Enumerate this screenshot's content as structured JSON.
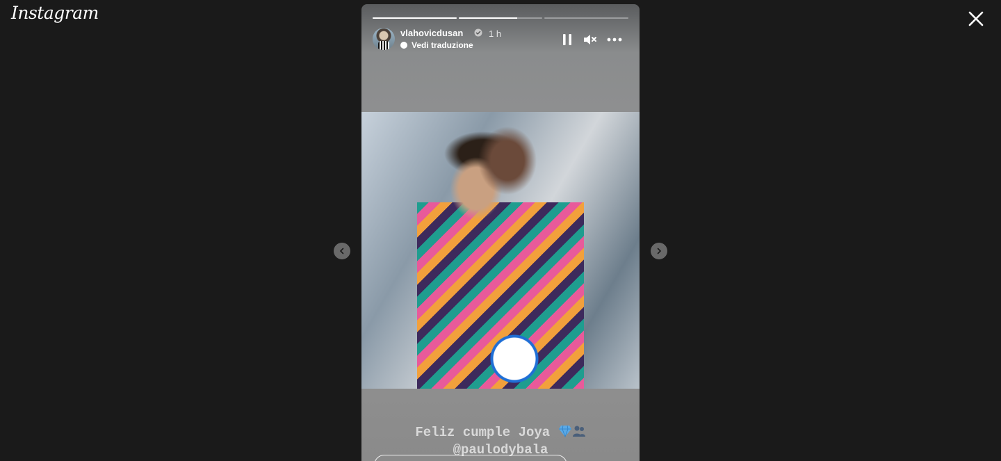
{
  "app": {
    "logo": "Instagram"
  },
  "story": {
    "username": "vlahovicdusan",
    "verified": true,
    "time": "1 h",
    "translate_label": "Vedi traduzione",
    "progress": [
      {
        "fill": 1.0
      },
      {
        "fill": 0.7
      },
      {
        "fill": 0.0
      }
    ],
    "caption_line1": "Feliz cumple Joya",
    "caption_line2": "@paulodybala",
    "reply_placeholder": ""
  },
  "icons": {
    "close": "close-icon",
    "pause": "pause-icon",
    "mute": "speaker-muted-icon",
    "more": "more-horizontal-icon",
    "prev": "chevron-left-icon",
    "next": "chevron-right-icon",
    "verified": "verified-badge-icon",
    "caption_emojis": [
      "gem-icon",
      "people-icon"
    ]
  },
  "colors": {
    "background": "#1a1a1a",
    "verified_blue": "#3897f0",
    "text": "#ffffff"
  }
}
